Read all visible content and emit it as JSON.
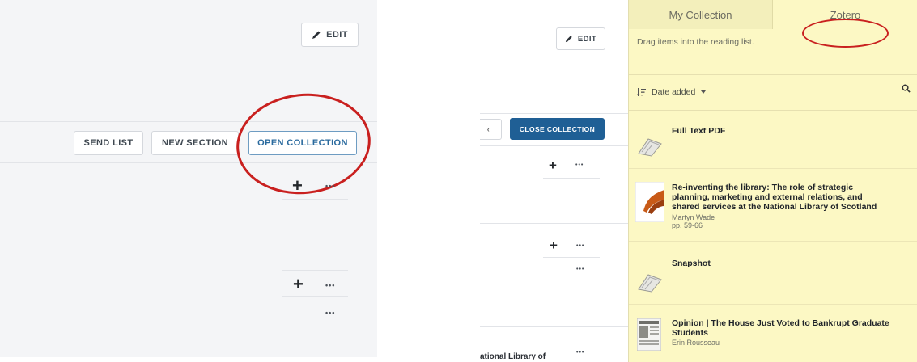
{
  "left": {
    "edit_label": "EDIT",
    "send_list_label": "SEND LIST",
    "new_section_label": "NEW SECTION",
    "open_collection_label": "OPEN COLLECTION",
    "plus_glyph": "+",
    "more_glyph": "•••"
  },
  "right": {
    "edit_label": "EDIT",
    "close_collection_label": "CLOSE COLLECTION",
    "truncated_text": "ational Library of",
    "collection": {
      "tabs": [
        "My Collection",
        "Zotero"
      ],
      "hint": "Drag items into the reading list.",
      "sort_label": "Date added",
      "items": [
        {
          "title": "Full Text PDF"
        },
        {
          "title_lines": [
            "Re-inventing the library: The role of strategic",
            "planning, marketing and external relations, and",
            "shared services at the National Library of Scotland"
          ],
          "author": "Martyn Wade",
          "pages": "pp. 59-66"
        },
        {
          "title": "Snapshot"
        },
        {
          "title_lines": [
            "Opinion | The House Just Voted to Bankrupt Graduate",
            "Students"
          ],
          "author": "Erin Rousseau"
        }
      ]
    }
  },
  "colors": {
    "annotation_red": "#c9201f",
    "collection_bg": "#fcf8c4",
    "primary_blue": "#1f5f95"
  }
}
